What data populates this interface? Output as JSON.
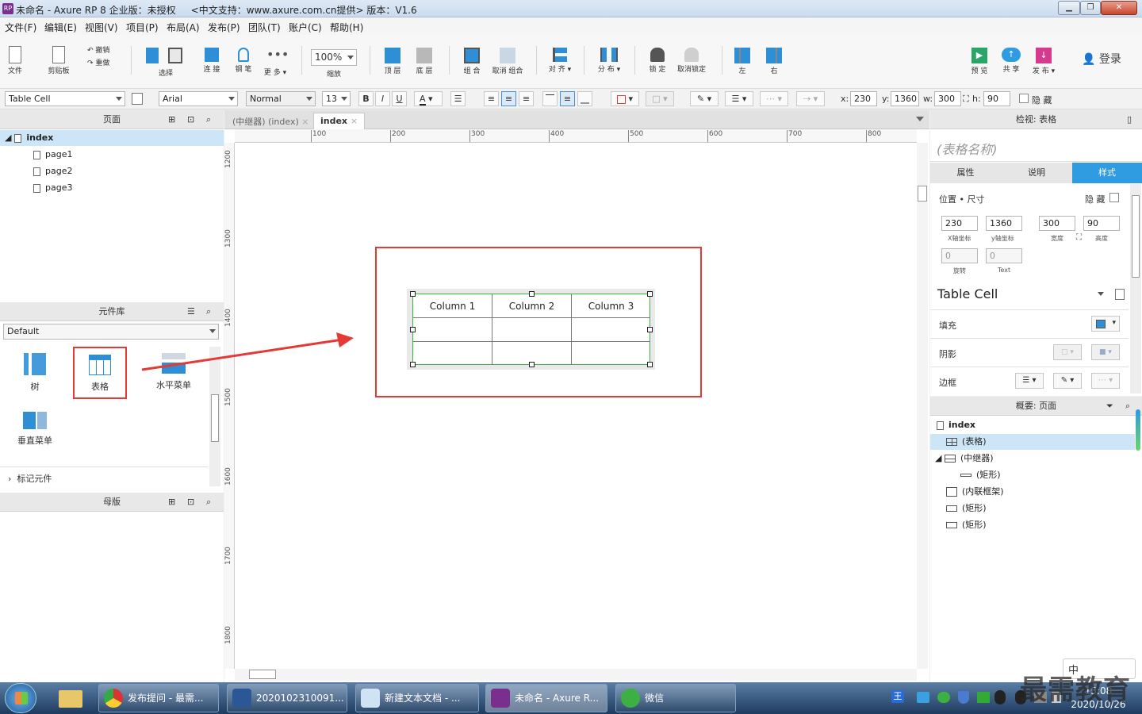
{
  "window": {
    "title": "未命名 - Axure RP 8 企业版：未授权",
    "subtitle": "<中文支持：www.axure.com.cn提供> 版本：V1.6",
    "logo": "RP"
  },
  "menu": [
    "文件(F)",
    "编辑(E)",
    "视图(V)",
    "项目(P)",
    "布局(A)",
    "发布(P)",
    "团队(T)",
    "账户(C)",
    "帮助(H)"
  ],
  "toolbar": {
    "file": "文件",
    "clipboard": "剪贴板",
    "undo": "撤销",
    "redo": "重做",
    "select": "选择",
    "connect": "连 接",
    "pen": "钢 笔",
    "more": "更 多 ▾",
    "zoom_value": "100%",
    "zoom": "缩放",
    "top": "顶 层",
    "bottom": "底 层",
    "group": "组 合",
    "ungroup": "取消 组合",
    "align": "对 齐 ▾",
    "distribute": "分 布 ▾",
    "lock": "锁 定",
    "unlock": "取消锁定",
    "left": "左",
    "right": "右",
    "preview": "预 览",
    "share": "共 享",
    "publish": "发 布 ▾",
    "login": "登录"
  },
  "format": {
    "style": "Table Cell",
    "font": "Arial",
    "weight": "Normal",
    "size": "13",
    "bold": "B",
    "italic": "I",
    "underline": "U",
    "x_label": "x:",
    "x": "230",
    "y_label": "y:",
    "y": "1360",
    "w_label": "w:",
    "w": "300",
    "h_label": "h:",
    "h": "90",
    "hidden": "隐 藏"
  },
  "pages_panel": {
    "title": "页面",
    "root": "index",
    "children": [
      "page1",
      "page2",
      "page3"
    ]
  },
  "library_panel": {
    "title": "元件库",
    "library": "Default",
    "widgets": [
      "树",
      "表格",
      "水平菜单",
      "垂直菜单"
    ],
    "marked": "标记元件"
  },
  "masters_panel": {
    "title": "母版"
  },
  "tabs": [
    {
      "label": "(中继器) (index)"
    },
    {
      "label": "index"
    }
  ],
  "rulers": {
    "h": [
      "100",
      "200",
      "300",
      "400",
      "500",
      "600",
      "700",
      "800"
    ],
    "v": [
      "1200",
      "1300",
      "1400",
      "1500",
      "1600",
      "1700",
      "1800"
    ]
  },
  "table": {
    "headers": [
      "Column 1",
      "Column 2",
      "Column 3"
    ]
  },
  "inspector": {
    "title": "检视: 表格",
    "name_placeholder": "(表格名称)",
    "tabs": [
      "属性",
      "说明",
      "样式"
    ],
    "pos_size": "位置 • 尺寸",
    "hidden": "隐 藏",
    "x": "230",
    "x_label": "X轴坐标",
    "y": "1360",
    "y_label": "y轴坐标",
    "w": "300",
    "w_label": "宽度",
    "h": "90",
    "h_label": "高度",
    "rotate": "0",
    "rotate_label": "旋转",
    "text_rotate": "0",
    "text_label": "Text",
    "style_name": "Table Cell",
    "fill": "填充",
    "shadow": "阴影",
    "border": "边框",
    "fill_color": "#2f8fd6"
  },
  "outline": {
    "title": "概要: 页面",
    "items": [
      "index",
      "(表格)",
      "(中继器)",
      "(矩形)",
      "(内联框架)",
      "(矩形)",
      "(矩形)"
    ]
  },
  "taskbar": {
    "items": [
      "发布提问 - 最需...",
      "2020102310091...",
      "新建文本文档 - ...",
      "未命名 - Axure R...",
      "微信"
    ],
    "ime": "中",
    "time": "15:08",
    "date": "2020/10/26",
    "watermark": "最需教育"
  },
  "colors": {
    "accent": "#2f8fd6",
    "highlight": "#e53935",
    "selection": "#3cb83c"
  }
}
